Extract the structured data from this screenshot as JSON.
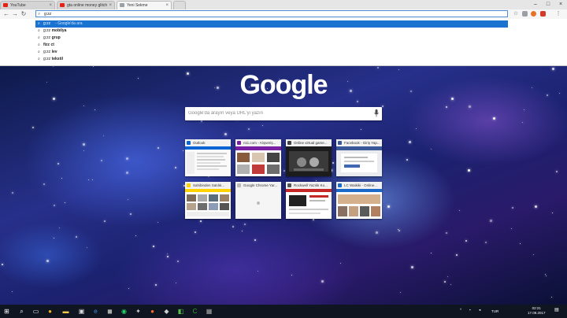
{
  "tabs": [
    {
      "label": "YouTube",
      "color": "#e62117"
    },
    {
      "label": "gta online money glitch",
      "color": "#e62117"
    },
    {
      "label": "Yeni Sekme",
      "color": "#9aa0a6"
    }
  ],
  "omnibox": {
    "value": "g:zz"
  },
  "suggestions": [
    {
      "prefix": "g:zz",
      "text": "",
      "hint": "- Google'da ara"
    },
    {
      "prefix": "g:zz ",
      "text": "mobilya",
      "hint": ""
    },
    {
      "prefix": "g:zz ",
      "text": "grup",
      "hint": ""
    },
    {
      "prefix": "",
      "text": "fizz ct",
      "hint": ""
    },
    {
      "prefix": "g:zz ",
      "text": "lev",
      "hint": ""
    },
    {
      "prefix": "g:zz ",
      "text": "tekstil",
      "hint": ""
    }
  ],
  "logo": "Google",
  "search": {
    "placeholder": "Google'da arayın veya URL'yi yazın"
  },
  "tiles": [
    {
      "title": "Outlook",
      "fav": "#0a64d2"
    },
    {
      "title": "n11.com - Alışveriş...",
      "fav": "#7a1fa2"
    },
    {
      "title": "Online virtual game...",
      "fav": "#444444"
    },
    {
      "title": "Facebook - Giriş Yap...",
      "fav": "#3b5998"
    },
    {
      "title": "Sahibinden Satılık...",
      "fav": "#ffd200"
    },
    {
      "title": "Google Chrome Yar...",
      "fav": "#bbbbbb"
    },
    {
      "title": "Rockwell Yazılık Ko...",
      "fav": "#555555"
    },
    {
      "title": "LC Waikiki - Online...",
      "fav": "#1b6ac9"
    }
  ],
  "taskbar": {
    "lang": "TUR",
    "time": "02:21",
    "date": "17.09.2017"
  },
  "colors": {
    "accent": "#1a73d1",
    "taskbar": "#101522"
  }
}
